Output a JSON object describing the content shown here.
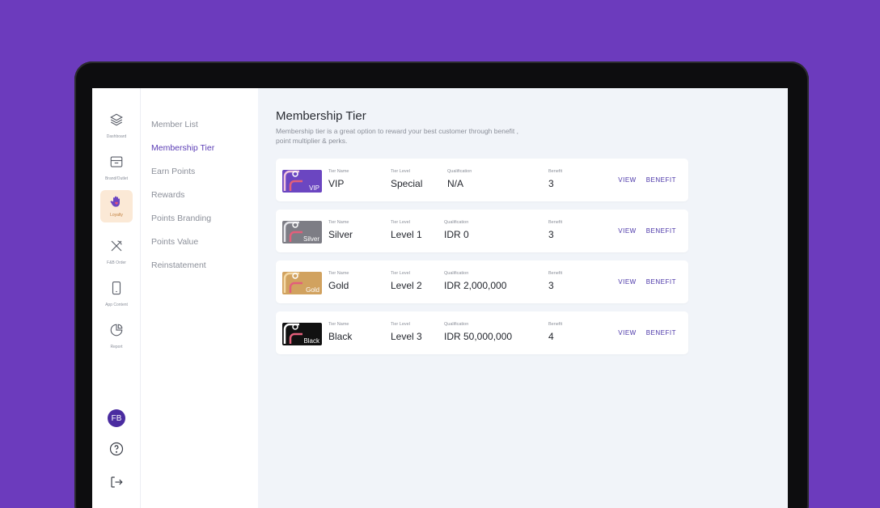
{
  "rail": {
    "items": [
      {
        "label": "Dashboard",
        "icon": "layers-icon"
      },
      {
        "label": "Brand/Outlet",
        "icon": "store-icon"
      },
      {
        "label": "Loyalty",
        "icon": "hand-heart-icon"
      },
      {
        "label": "F&B Order",
        "icon": "utensils-icon"
      },
      {
        "label": "App Content",
        "icon": "phone-icon"
      },
      {
        "label": "Report",
        "icon": "pie-chart-icon"
      }
    ],
    "avatar_initials": "FB"
  },
  "submenu": {
    "items": [
      "Member List",
      "Membership Tier",
      "Earn Points",
      "Rewards",
      "Points Branding",
      "Points Value",
      "Reinstatement"
    ]
  },
  "main": {
    "title": "Membership Tier",
    "description": "Membership tier is a great option to reward your best customer through benefit , point multiplier & perks."
  },
  "tier_labels": {
    "name": "Tier Name",
    "level": "Tier Level",
    "qualification": "Qualification",
    "benefit": "Benefit",
    "view": "VIEW",
    "benefit_action": "BENEFIT"
  },
  "tiers": [
    {
      "tag": "VIP",
      "name": "VIP",
      "level": "Special",
      "qualification": "N/A",
      "benefit": "3",
      "color": "#6b46c1"
    },
    {
      "tag": "Silver",
      "name": "Silver",
      "level": "Level 1",
      "qualification": "IDR 0",
      "benefit": "3",
      "color": "#7d7d85"
    },
    {
      "tag": "Gold",
      "name": "Gold",
      "level": "Level 2",
      "qualification": "IDR 2,000,000",
      "benefit": "3",
      "color": "#d1a25f"
    },
    {
      "tag": "Black",
      "name": "Black",
      "level": "Level 3",
      "qualification": "IDR 50,000,000",
      "benefit": "4",
      "color": "#111111"
    }
  ]
}
